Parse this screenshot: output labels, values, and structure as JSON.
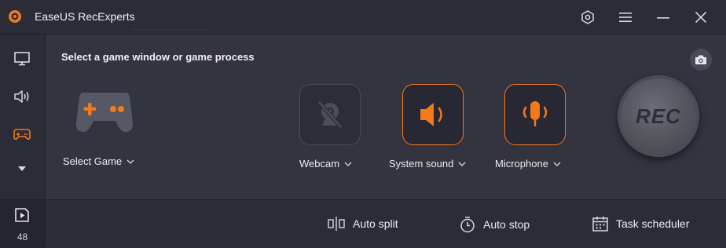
{
  "app": {
    "title": "EaseUS RecExperts"
  },
  "colors": {
    "accent": "#f27a1a",
    "background": "#2b2c37",
    "panel": "#33343f"
  },
  "titlebar": {
    "icons": [
      "settings-icon",
      "menu-icon",
      "minimize-icon",
      "close-icon"
    ]
  },
  "sidebar": {
    "items": [
      {
        "icon": "monitor-icon",
        "label": ""
      },
      {
        "icon": "speaker-icon",
        "label": ""
      },
      {
        "icon": "gamepad-icon",
        "label": "",
        "active": true
      },
      {
        "icon": "triangle-down-icon",
        "label": ""
      }
    ],
    "recordings_count": "48"
  },
  "main": {
    "prompt": "Select a game window or game process",
    "select_game_label": "Select Game",
    "sources": [
      {
        "name": "webcam",
        "label": "Webcam",
        "enabled": false
      },
      {
        "name": "system-sound",
        "label": "System sound",
        "enabled": true
      },
      {
        "name": "microphone",
        "label": "Microphone",
        "enabled": true
      }
    ],
    "rec_label": "REC"
  },
  "footer": {
    "auto_split": "Auto split",
    "auto_stop": "Auto stop",
    "task_scheduler": "Task scheduler"
  }
}
